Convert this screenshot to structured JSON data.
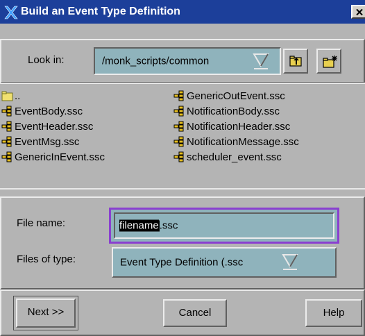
{
  "window": {
    "title": "Build an Event Type Definition",
    "close_glyph": "✕"
  },
  "look_in": {
    "label": "Look in:",
    "value": "/monk_scripts/common"
  },
  "toolbar": {
    "up_folder_icon": "up-folder-icon",
    "new_folder_icon": "new-folder-icon"
  },
  "files": {
    "column1": [
      {
        "name": "..",
        "icon": "folder-icon"
      },
      {
        "name": "EventBody.ssc",
        "icon": "script-file-icon"
      },
      {
        "name": "EventHeader.ssc",
        "icon": "script-file-icon"
      },
      {
        "name": "EventMsg.ssc",
        "icon": "script-file-icon"
      },
      {
        "name": "GenericInEvent.ssc",
        "icon": "script-file-icon"
      }
    ],
    "column2": [
      {
        "name": "GenericOutEvent.ssc",
        "icon": "script-file-icon"
      },
      {
        "name": "NotificationBody.ssc",
        "icon": "script-file-icon"
      },
      {
        "name": "NotificationHeader.ssc",
        "icon": "script-file-icon"
      },
      {
        "name": "NotificationMessage.ssc",
        "icon": "script-file-icon"
      },
      {
        "name": "scheduler_event.ssc",
        "icon": "script-file-icon"
      }
    ]
  },
  "file_name": {
    "label": "File name:",
    "selected_part": "filename",
    "rest": ".ssc"
  },
  "file_type": {
    "label": "Files of type:",
    "value": "Event Type Definition (.ssc"
  },
  "buttons": {
    "next": "Next >>",
    "cancel": "Cancel",
    "help": "Help"
  },
  "colors": {
    "titlebar": "#1c3f9a",
    "field": "#8fb3bc",
    "focus_border": "#8a3fd0",
    "face": "#b4b4b4"
  }
}
